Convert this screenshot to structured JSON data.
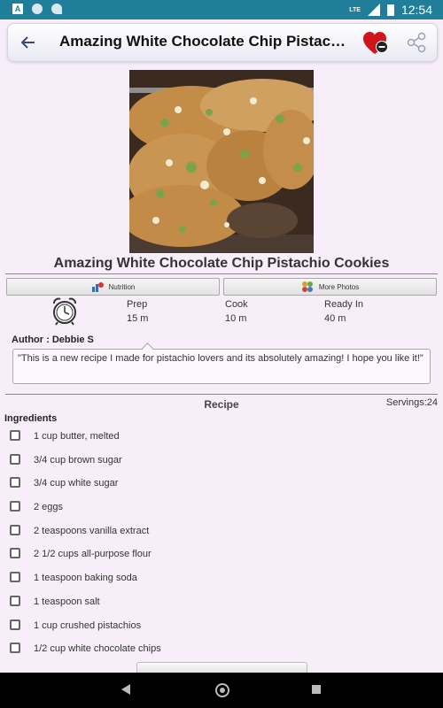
{
  "status_bar": {
    "left_icon": "A",
    "time": "12:54",
    "network": "LTE"
  },
  "app_bar": {
    "back_icon": "arrow-left-icon",
    "title": "Amazing White Chocolate Chip Pistachio Cookies",
    "favorite_icon": "heart-remove-icon",
    "share_icon": "share-icon"
  },
  "recipe": {
    "title": "Amazing White Chocolate Chip Pistachio Cookies",
    "nutrition_label": "Nutrition",
    "more_photos_label": "More Photos",
    "times": [
      {
        "label": "Prep",
        "value": "15 m"
      },
      {
        "label": "Cook",
        "value": "10 m"
      },
      {
        "label": "Ready In",
        "value": "40 m"
      }
    ],
    "author": "Author : Debbie S",
    "description": "\"This is a new recipe I made for pistachio lovers and its absolutely amazing! I hope you like it!\"",
    "section_title": "Recipe",
    "servings": "Servings:24",
    "ingredients_title": "Ingredients",
    "ingredients": [
      "1 cup butter, melted",
      "3/4 cup brown sugar",
      "3/4 cup white sugar",
      "2 eggs",
      "2 teaspoons vanilla extract",
      "2 1/2 cups all-purpose flour",
      "1 teaspoon baking soda",
      "1 teaspoon salt",
      "1 cup crushed pistachios",
      "1/2 cup white chocolate chips"
    ]
  },
  "colors": {
    "status_bar": "#1f7f9a",
    "background": "#f8eefa",
    "favorite": "#d0141b"
  }
}
